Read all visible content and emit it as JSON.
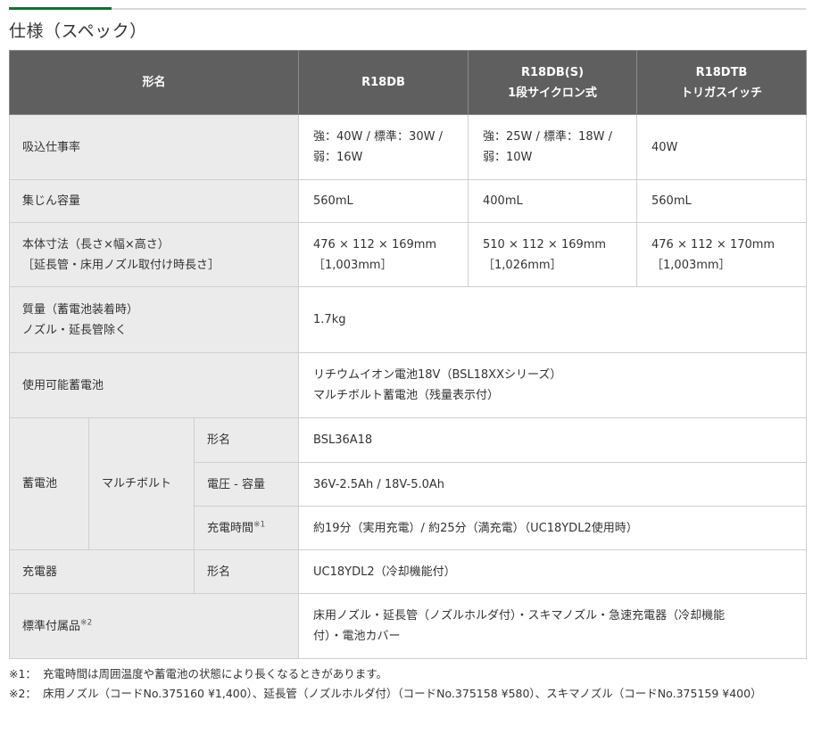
{
  "page_title": "仕様（スペック）",
  "header": {
    "col_label": "形名",
    "models": [
      {
        "line1": "R18DB",
        "line2": ""
      },
      {
        "line1": "R18DB(S)",
        "line2": "1段サイクロン式"
      },
      {
        "line1": "R18DTB",
        "line2": "トリガスイッチ"
      }
    ]
  },
  "rows": {
    "suction": {
      "label": "吸込仕事率",
      "values": [
        {
          "line1": "強：40W / 標準：30W /",
          "line2": "弱：16W"
        },
        {
          "line1": "強：25W / 標準：18W /",
          "line2": "弱：10W"
        },
        {
          "line1": "40W",
          "line2": ""
        }
      ]
    },
    "dust": {
      "label": "集じん容量",
      "values": [
        "560mL",
        "400mL",
        "560mL"
      ]
    },
    "size": {
      "label_line1": "本体寸法（長さ×幅×高さ）",
      "label_line2": "［延長管・床用ノズル取付け時長さ］",
      "values": [
        {
          "line1": "476 × 112 × 169mm",
          "line2": "［1,003mm］"
        },
        {
          "line1": "510 × 112 × 169mm",
          "line2": "［1,026mm］"
        },
        {
          "line1": "476 × 112 × 170mm",
          "line2": "［1,003mm］"
        }
      ]
    },
    "mass": {
      "label_line1": "質量（蓄電池装着時）",
      "label_line2": "ノズル・延長管除く",
      "value": "1.7kg"
    },
    "usable_battery": {
      "label": "使用可能蓄電池",
      "line1": "リチウムイオン電池18V（BSL18XXシリーズ）",
      "line2": "マルチボルト蓄電池（残量表示付）"
    },
    "battery": {
      "label": "蓄電池",
      "sub_label": "マルチボルト",
      "items": [
        {
          "label": "形名",
          "sup": "",
          "value": "BSL36A18"
        },
        {
          "label": "電圧 - 容量",
          "sup": "",
          "value": "36V-2.5Ah / 18V-5.0Ah"
        },
        {
          "label": "充電時間",
          "sup": "※1",
          "value": "約19分（実用充電）/ 約25分（満充電）（UC18YDL2使用時）"
        }
      ]
    },
    "charger": {
      "label": "充電器",
      "sub_label": "形名",
      "value": "UC18YDL2（冷却機能付）"
    },
    "accessories": {
      "label": "標準付属品",
      "sup": "※2",
      "line1": "床用ノズル・延長管（ノズルホルダ付）・スキマノズル・急速充電器（冷却機能",
      "line2": "付）・電池カバー"
    }
  },
  "notes": [
    {
      "mark": "※1：",
      "text": "充電時間は周囲温度や蓄電池の状態により長くなるときがあります。"
    },
    {
      "mark": "※2：",
      "text": "床用ノズル（コードNo.375160 ¥1,400）、延長管（ノズルホルダ付）（コードNo.375158 ¥580）、スキマノズル（コードNo.375159 ¥400）"
    }
  ],
  "colors": {
    "accent": "#1a6b3a",
    "header_bg": "#5f5f5f",
    "label_bg": "#ebebeb",
    "border": "#cfcfcf"
  }
}
